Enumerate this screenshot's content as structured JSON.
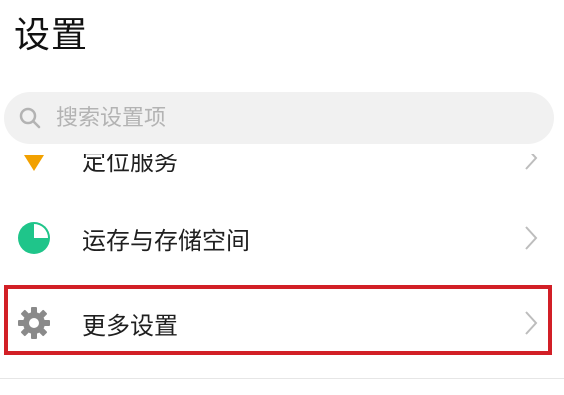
{
  "header": {
    "title": "设置"
  },
  "search": {
    "placeholder": "搜索设置项",
    "value": ""
  },
  "items": [
    {
      "label": "定位服务",
      "icon": "location-icon",
      "color": "#f2a100"
    },
    {
      "label": "运存与存储空间",
      "icon": "storage-pie-icon",
      "color": "#1fc58a"
    },
    {
      "label": "更多设置",
      "icon": "gear-icon",
      "color": "#8a8a8a",
      "highlighted": true
    }
  ],
  "colors": {
    "highlight": "#d21f26",
    "search_bg": "#f1f1f1"
  }
}
